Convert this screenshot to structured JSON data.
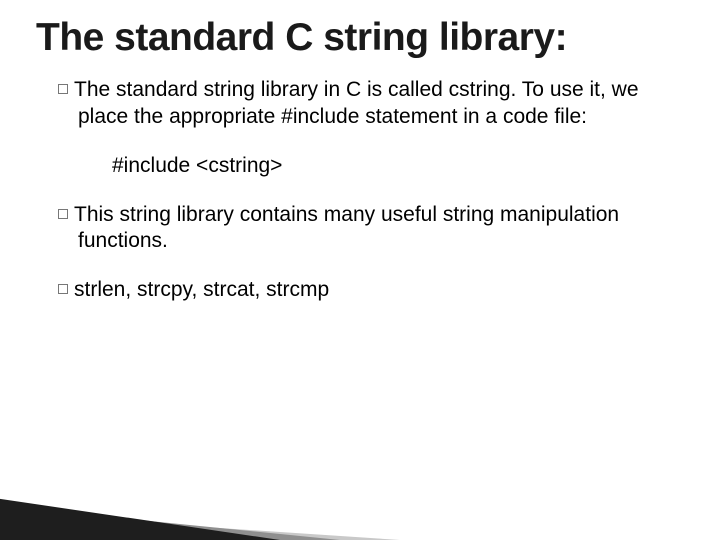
{
  "title": "The standard C string library:",
  "paragraphs": {
    "p1": {
      "lead": "The",
      "rest": " standard string library in C is called cstring. To use it, we place the appropriate #include statement in a code file:"
    },
    "code": "#include <cstring>",
    "p2": {
      "lead": "This",
      "rest": " string library contains many useful string manipulation functions."
    },
    "p3": {
      "lead": "strlen,",
      "rest": " strcpy, strcat, strcmp"
    }
  }
}
